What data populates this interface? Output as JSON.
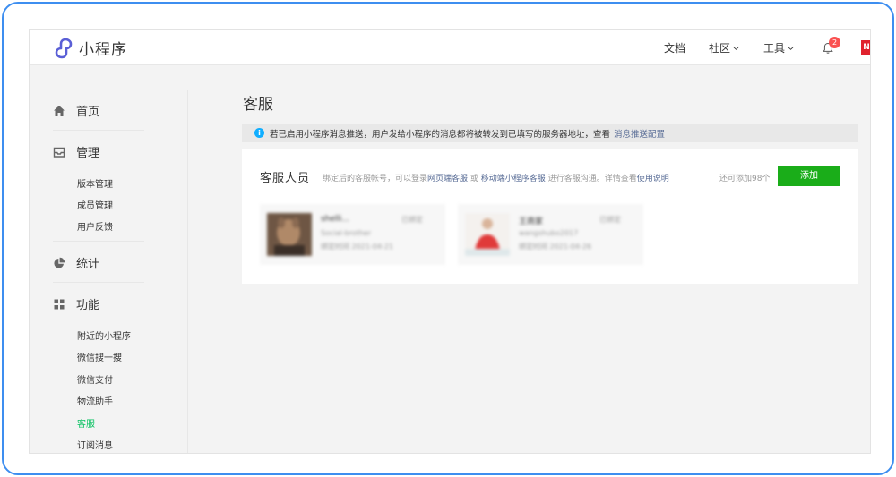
{
  "app": {
    "name": "小程序"
  },
  "topnav": {
    "docs": "文档",
    "community": "社区",
    "tools": "工具",
    "notification_count": "2",
    "avatar_letter": "N"
  },
  "sidebar": {
    "home": "首页",
    "manage": "管理",
    "manage_items": [
      "版本管理",
      "成员管理",
      "用户反馈"
    ],
    "stats": "统计",
    "features": "功能",
    "feature_items": [
      "附近的小程序",
      "微信搜一搜",
      "微信支付",
      "物流助手",
      "客服",
      "订阅消息"
    ],
    "active_item": "客服"
  },
  "main": {
    "title": "客服",
    "notice": {
      "text": "若已启用小程序消息推送，用户发给小程序的消息都将被转发到已填写的服务器地址，查看",
      "link": "消息推送配置"
    },
    "card": {
      "title": "客服人员",
      "desc_prefix": "绑定后的客服帐号，可以登录",
      "desc_link1": "网页端客服",
      "desc_or": "或",
      "desc_link2": "移动端小程序客服",
      "desc_mid": "进行客服沟通。详情查看",
      "desc_link3": "使用说明",
      "quota": "还可添加98个",
      "add_button": "添加"
    },
    "members": [
      {
        "name": "shelli...",
        "account": "Social-brother",
        "bind_label": "绑定时间",
        "bind_date": "2021-04-21",
        "status": "已绑定"
      },
      {
        "name": "王商家",
        "account": "wangshubo2017",
        "bind_label": "绑定时间",
        "bind_date": "2021-04-26",
        "status": "已绑定"
      }
    ]
  },
  "colors": {
    "accent_green": "#07c160",
    "button_green": "#1aad19",
    "link_blue": "#576b95",
    "frame_blue": "#3d8ef0"
  }
}
